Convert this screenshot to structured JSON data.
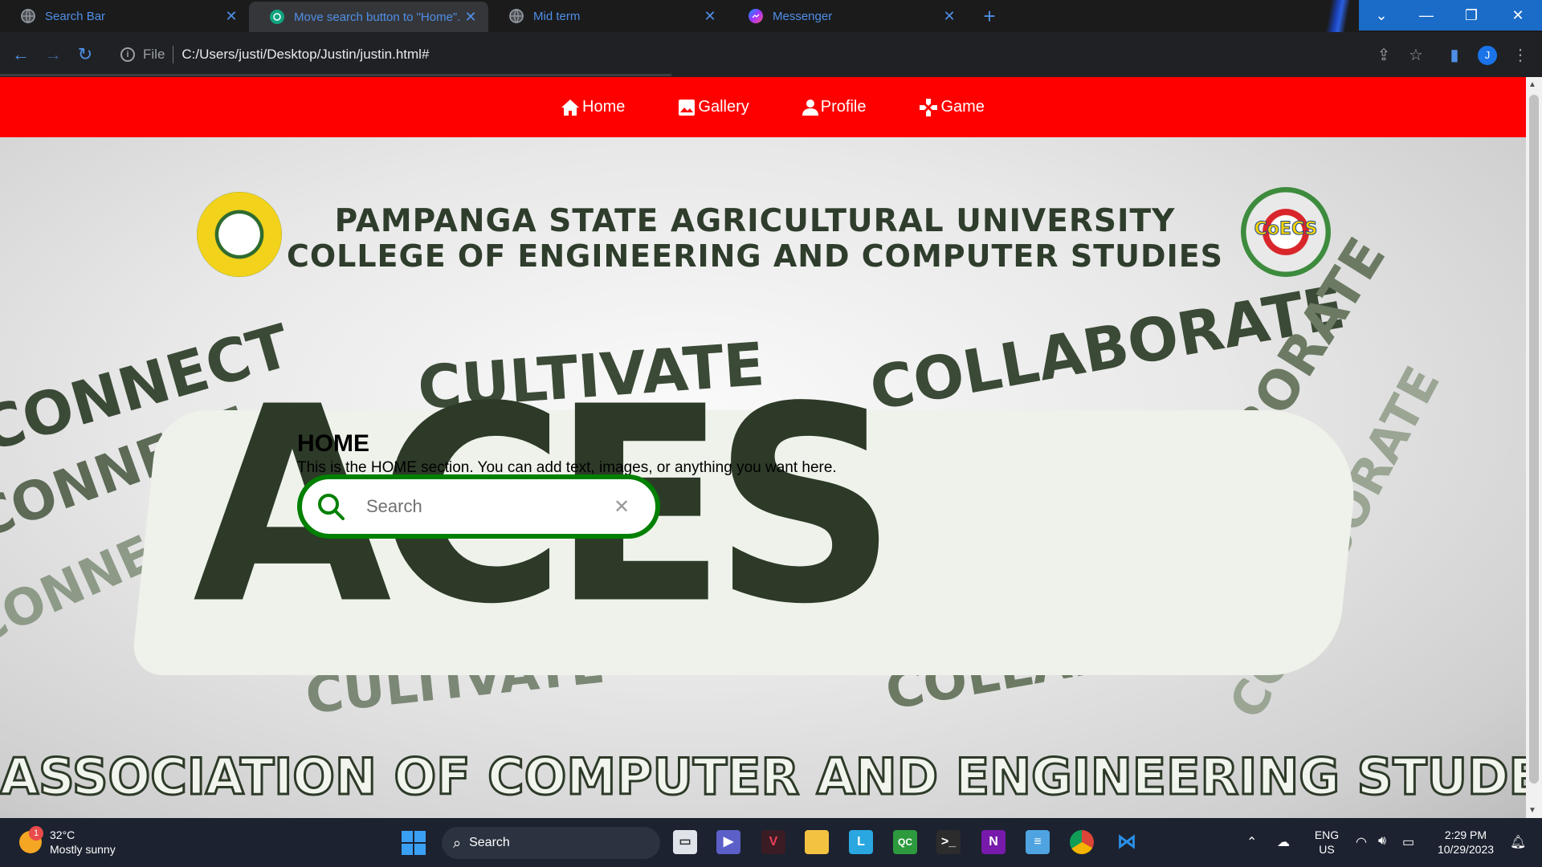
{
  "browser": {
    "tabs": [
      {
        "title": "Search Bar",
        "active": false,
        "favicon": "globe-icon"
      },
      {
        "title": "Move search button to \"Home\".",
        "active": true,
        "favicon": "chatgpt-icon"
      },
      {
        "title": "Mid term",
        "active": false,
        "favicon": "globe-icon"
      },
      {
        "title": "Messenger",
        "active": false,
        "favicon": "messenger-icon"
      }
    ],
    "omnibox": {
      "scheme": "File",
      "url": "C:/Users/justi/Desktop/Justin/justin.html#"
    },
    "profile_initial": "J"
  },
  "site": {
    "nav": [
      {
        "label": "Home",
        "icon": "home-icon"
      },
      {
        "label": "Gallery",
        "icon": "image-icon"
      },
      {
        "label": "Profile",
        "icon": "person-icon"
      },
      {
        "label": "Game",
        "icon": "gamepad-icon"
      }
    ],
    "banner": {
      "university": "PAMPANGA STATE AGRICULTURAL UNIVERSITY",
      "college": "COLLEGE OF ENGINEERING AND COMPUTER STUDIES",
      "coecs_label": "CoECS",
      "wave_words": [
        "CONNECT",
        "CULTIVATE",
        "COLLABORATE"
      ],
      "logo_text": "ACES",
      "footer": "ASSOCIATION OF COMPUTER AND ENGINEERING STUDENTS"
    },
    "home": {
      "title": "HOME",
      "description": "This is the HOME section. You can add text, images, or anything you want here."
    },
    "search": {
      "placeholder": "Search"
    }
  },
  "taskbar": {
    "weather": {
      "temp": "32°C",
      "condition": "Mostly sunny",
      "badge": "1"
    },
    "search_label": "Search",
    "language": {
      "lang": "ENG",
      "region": "US"
    },
    "time": "2:29 PM",
    "date": "10/29/2023"
  },
  "colors": {
    "nav_red": "#ff0000",
    "search_border": "#008000",
    "aces_green": "#2d3a28"
  }
}
